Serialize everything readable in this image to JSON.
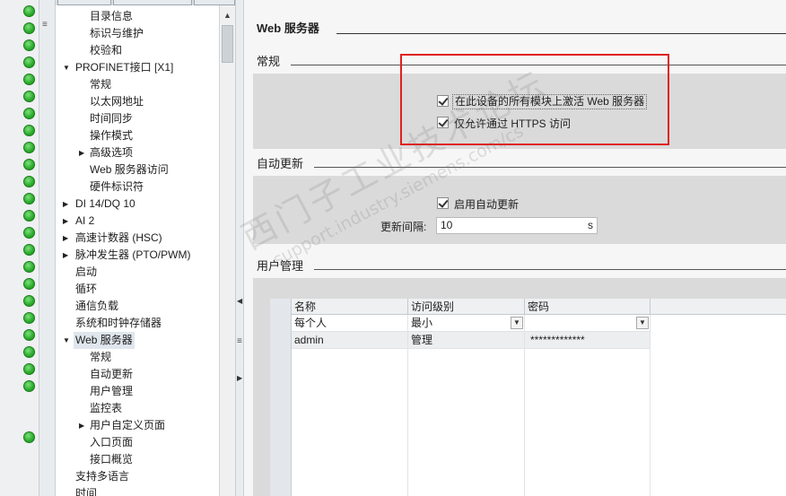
{
  "tree": {
    "items": [
      {
        "label": "目录信息",
        "arrow": ""
      },
      {
        "label": "标识与维护",
        "arrow": ""
      },
      {
        "label": "校验和",
        "arrow": ""
      },
      {
        "label": "PROFINET接口 [X1]",
        "arrow": "▼"
      },
      {
        "label": "常规",
        "arrow": ""
      },
      {
        "label": "以太网地址",
        "arrow": ""
      },
      {
        "label": "时间同步",
        "arrow": ""
      },
      {
        "label": "操作模式",
        "arrow": ""
      },
      {
        "label": "高级选项",
        "arrow": "▶"
      },
      {
        "label": "Web 服务器访问",
        "arrow": ""
      },
      {
        "label": "硬件标识符",
        "arrow": ""
      },
      {
        "label": "DI 14/DQ 10",
        "arrow": "▶"
      },
      {
        "label": "AI 2",
        "arrow": "▶"
      },
      {
        "label": "高速计数器 (HSC)",
        "arrow": "▶"
      },
      {
        "label": "脉冲发生器 (PTO/PWM)",
        "arrow": "▶"
      },
      {
        "label": "启动",
        "arrow": ""
      },
      {
        "label": "循环",
        "arrow": ""
      },
      {
        "label": "通信负载",
        "arrow": ""
      },
      {
        "label": "系统和时钟存储器",
        "arrow": ""
      },
      {
        "label": "Web 服务器",
        "arrow": "▼"
      },
      {
        "label": "常规",
        "arrow": ""
      },
      {
        "label": "自动更新",
        "arrow": ""
      },
      {
        "label": "用户管理",
        "arrow": ""
      },
      {
        "label": "监控表",
        "arrow": ""
      },
      {
        "label": "用户自定义页面",
        "arrow": "▶"
      },
      {
        "label": "入口页面",
        "arrow": ""
      },
      {
        "label": "接口概览",
        "arrow": ""
      },
      {
        "label": "支持多语言",
        "arrow": ""
      },
      {
        "label": "时间",
        "arrow": ""
      }
    ]
  },
  "icons": {
    "expanded": "triangle-down-icon",
    "collapsed": "triangle-right-icon",
    "status": "green-status-icon",
    "checkbox": "checkmark-icon",
    "dropdown": "chevron-down-icon"
  },
  "colors": {
    "highlight_box": "#e02020",
    "status_ok": "#2fb02f",
    "panel_bg": "#dadada"
  },
  "content": {
    "title": "Web 服务器",
    "general": {
      "title": "常规",
      "activate_label": "在此设备的所有模块上激活 Web 服务器",
      "activate_checked": true,
      "https_label": "仅允许通过 HTTPS 访问",
      "https_checked": true
    },
    "auto_update": {
      "title": "自动更新",
      "enable_label": "启用自动更新",
      "enable_checked": true,
      "interval_label": "更新间隔:",
      "interval_value": "10",
      "interval_unit": "s"
    },
    "user_mgmt": {
      "title": "用户管理",
      "columns": [
        "名称",
        "访问级别",
        "密码"
      ],
      "rows": [
        {
          "name": "每个人",
          "level": "最小",
          "password": ""
        },
        {
          "name": "admin",
          "level": "管理",
          "password": "*************"
        }
      ]
    }
  },
  "watermark": {
    "line1": "西门子工业技术论坛",
    "line2": "support.industry.siemens.com/cs"
  }
}
